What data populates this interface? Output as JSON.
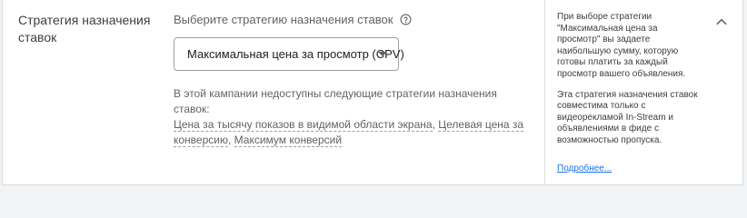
{
  "section": {
    "title": "Стратегия назначения ставок"
  },
  "strategy": {
    "prompt": "Выберите стратегию назначения ставок",
    "selected_value": "Максимальная цена за просмотр (CPV)",
    "unavailable_intro": "В этой кампании недоступны следующие стратегии назначения ставок:",
    "unavailable_items": [
      "Цена за тысячу показов в видимой области экрана",
      "Целевая цена за конверсию",
      "Максимум конверсий"
    ],
    "separator": ", "
  },
  "help": {
    "paragraph1": "При выборе стратегии \"Максимальная цена за просмотр\" вы задаете наибольшую сумму, которую готовы платить за каждый просмотр вашего объявления.",
    "paragraph2": "Эта стратегия назначения ставок совместима только с видеорекламой In-Stream и объявлениями в фиде с возможностью пропуска.",
    "learn_more": "Подробнее..."
  },
  "icons": {
    "help": "help-circle-icon",
    "dropdown": "caret-down-icon",
    "collapse": "chevron-up-icon"
  },
  "colors": {
    "link": "#1a73e8",
    "text_primary": "#202124",
    "text_secondary": "#5f6368",
    "border": "#dadce0"
  }
}
